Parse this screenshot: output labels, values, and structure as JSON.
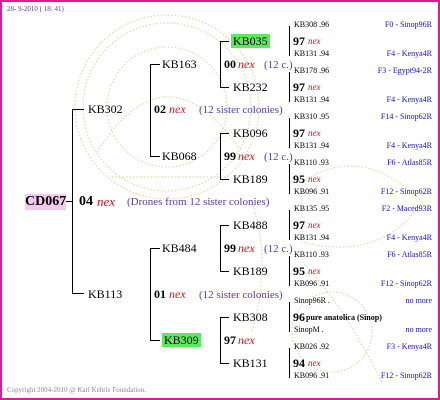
{
  "header_date": "28- 9-2010 ( 18: 41)",
  "footer": "Copyright 2004-2010 @ Karl Kehrle Foundation.",
  "watermark": "Koenigin",
  "root": {
    "id": "CD067",
    "year": "04",
    "nex": "nex",
    "note": "(Drones from 12 sister colonies)"
  },
  "p1": {
    "id": "KB302",
    "year": "02",
    "nex": "nex",
    "note": "(12 sister colonies)"
  },
  "p2": {
    "id": "KB113",
    "year": "01",
    "nex": "nex",
    "note": "(12 sister colonies)"
  },
  "g1": {
    "id": "KB163",
    "year": "00",
    "nex": "nex",
    "note": "(12 c.)"
  },
  "g2": {
    "id": "KB068",
    "year": "99",
    "nex": "nex",
    "note": "(12 c.)"
  },
  "g3": {
    "id": "KB484",
    "year": "99",
    "nex": "nex",
    "note": "(12 c.)"
  },
  "g4": {
    "id": "KB309",
    "year": "97",
    "nex": "nex"
  },
  "ggg": [
    {
      "id": "KB035",
      "year": "97",
      "nex": "nex"
    },
    {
      "id": "KB232",
      "year": "97",
      "nex": "nex"
    },
    {
      "id": "KB096",
      "year": "97",
      "nex": "nex"
    },
    {
      "id": "KB189",
      "year": "95",
      "nex": "nex"
    },
    {
      "id": "KB488",
      "year": "97",
      "nex": "nex"
    },
    {
      "id": "KB189",
      "year": "95",
      "nex": "nex"
    },
    {
      "id": "KB308",
      "year": "96",
      "extra": "pure anatolica (Sinop)"
    },
    {
      "id": "KB131",
      "year": "94",
      "nex": "nex"
    }
  ],
  "right": [
    {
      "code": "KB308 .96",
      "origin": "F0 - Sinop96R"
    },
    {
      "code": "KB131 .94",
      "origin": "F4 - Kenya4R"
    },
    {
      "code": "KB178 .96",
      "origin": "F3 - Egypt94-2R"
    },
    {
      "code": "KB131 .94",
      "origin": "F4 - Kenya4R"
    },
    {
      "code": "KB310 .95",
      "origin": "F14 - Sinop62R"
    },
    {
      "code": "KB131 .94",
      "origin": "F4 - Kenya4R"
    },
    {
      "code": "KB110 .93",
      "origin": "F6 - Atlas85R"
    },
    {
      "code": "KB096 .91",
      "origin": "F12 - Sinop62R"
    },
    {
      "code": "KB135 .95",
      "origin": "F2 - Maced93R"
    },
    {
      "code": "KB131 .94",
      "origin": "F4 - Kenya4R"
    },
    {
      "code": "KB110 .93",
      "origin": "F6 - Atlas85R"
    },
    {
      "code": "KB096 .91",
      "origin": "F12 - Sinop62R"
    },
    {
      "code": "Sinop96R .",
      "origin": "no more"
    },
    {
      "code": "SinopM .",
      "origin": "no more"
    },
    {
      "code": "KB026 .92",
      "origin": "F3 - Kenya4R"
    },
    {
      "code": "KB096 .91",
      "origin": "F12 - Sinop62R"
    }
  ]
}
